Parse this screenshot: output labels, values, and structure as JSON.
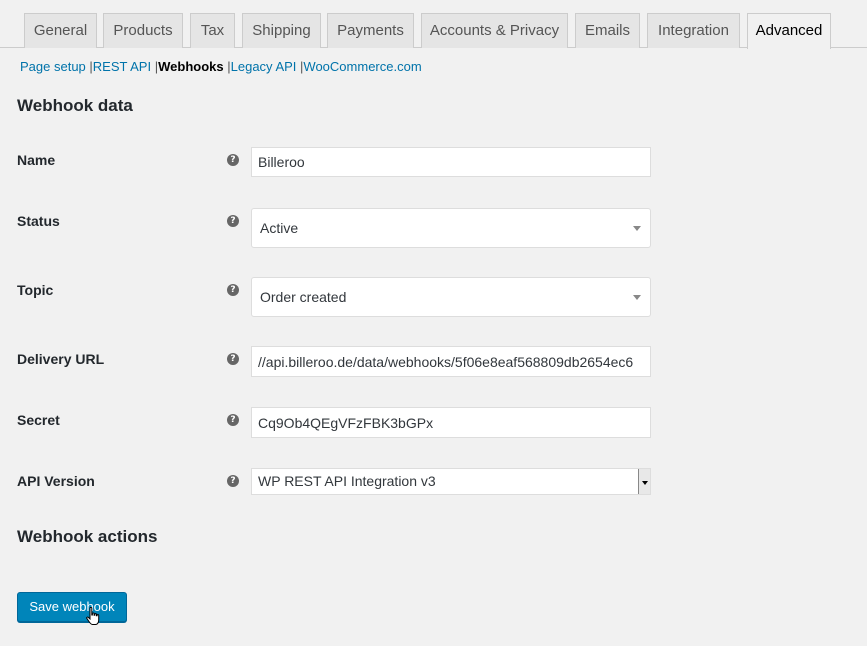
{
  "tabs": [
    {
      "label": "General"
    },
    {
      "label": "Products"
    },
    {
      "label": "Tax"
    },
    {
      "label": "Shipping"
    },
    {
      "label": "Payments"
    },
    {
      "label": "Accounts & Privacy"
    },
    {
      "label": "Emails"
    },
    {
      "label": "Integration"
    },
    {
      "label": "Advanced",
      "active": true
    }
  ],
  "subnav": {
    "items": [
      "Page setup",
      "REST API",
      "Webhooks",
      "Legacy API",
      "WooCommerce.com"
    ],
    "current": "Webhooks",
    "separator": "|"
  },
  "section_webhook_data": "Webhook data",
  "form": {
    "name_label": "Name",
    "name_value": "Billeroo",
    "status_label": "Status",
    "status_value": "Active",
    "topic_label": "Topic",
    "topic_value": "Order created",
    "delivery_url_label": "Delivery URL",
    "delivery_url_value": "//api.billeroo.de/data/webhooks/5f06e8eaf568809db2654ec6",
    "secret_label": "Secret",
    "secret_value": "Cq9Ob4QEgVFzFBK3bGPx",
    "api_version_label": "API Version",
    "api_version_value": "WP REST API Integration v3",
    "help_glyph": "?"
  },
  "section_webhook_actions": "Webhook actions",
  "save_button": "Save webhook",
  "icons": {
    "help": "help-icon",
    "cursor": "hand-pointer-cursor"
  },
  "colors": {
    "link": "#0073aa",
    "button": "#0085ba",
    "background": "#f1f1f1"
  }
}
